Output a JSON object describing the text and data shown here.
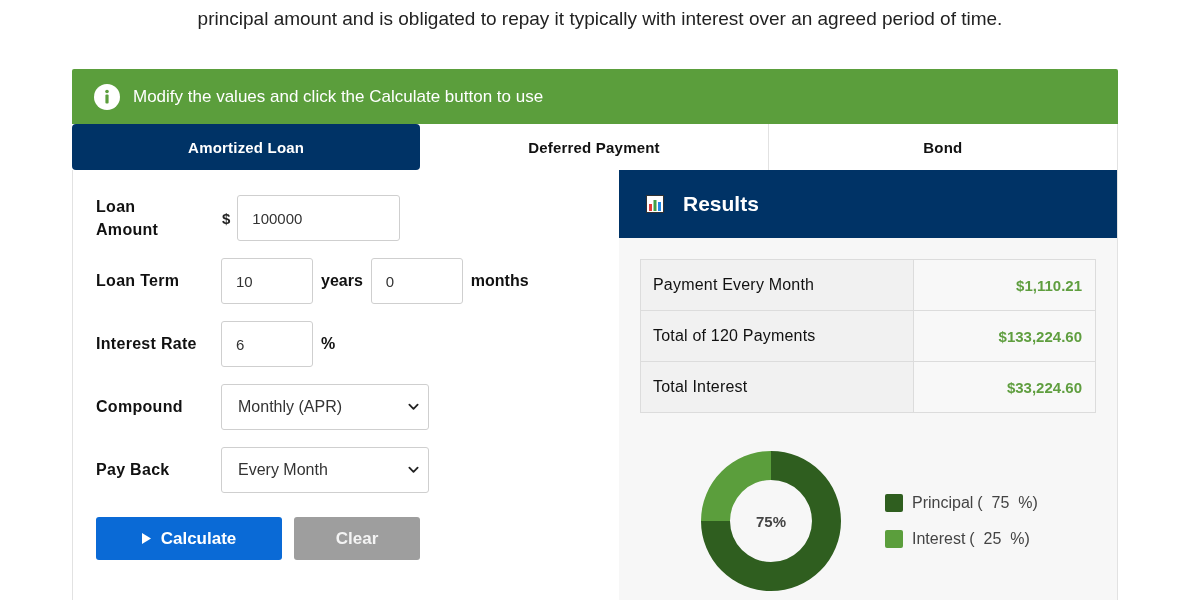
{
  "intro": {
    "text": "principal amount and is obligated to repay it typically with interest over an agreed period of time."
  },
  "notice": {
    "text": "Modify the values and click the Calculate button to use"
  },
  "tabs": [
    {
      "label": "Amortized Loan",
      "selected": true
    },
    {
      "label": "Deferred Payment",
      "selected": false
    },
    {
      "label": "Bond",
      "selected": false
    }
  ],
  "form": {
    "fields": [
      {
        "kind": "input",
        "label": "Loan Amount",
        "prefix": "$",
        "value": "100000"
      },
      {
        "kind": "term",
        "label": "Loan Term",
        "inputs": [
          {
            "value": "10",
            "unit": "years"
          },
          {
            "value": "0",
            "unit": "months"
          }
        ]
      },
      {
        "kind": "input",
        "label": "Interest Rate",
        "value": "6",
        "suffix": "%"
      },
      {
        "kind": "select",
        "label": "Compound",
        "value": "Monthly (APR)"
      },
      {
        "kind": "select",
        "label": "Pay Back",
        "value": "Every Month"
      }
    ],
    "buttons": [
      {
        "kind": "primary",
        "label": "Calculate"
      },
      {
        "kind": "secondary",
        "label": "Clear"
      }
    ]
  },
  "results": {
    "title": "Results",
    "rows": [
      {
        "label": "Payment Every Month",
        "value": "$1,110.21"
      },
      {
        "label": "Total of 120 Payments",
        "value": "$133,224.60"
      },
      {
        "label": "Total Interest",
        "value": "$33,224.60"
      }
    ],
    "chart": {
      "center_label": "75%",
      "legend": [
        {
          "share": "(  75  %)",
          "color": "#2f5e1f"
        },
        {
          "share": "(  25  %)",
          "color": "#5b9e3c"
        }
      ],
      "chart_data": {
        "type": "donut",
        "categories": [
          "Principal",
          "Interest"
        ],
        "values": [
          75,
          25
        ],
        "legend": "right"
      }
    }
  }
}
